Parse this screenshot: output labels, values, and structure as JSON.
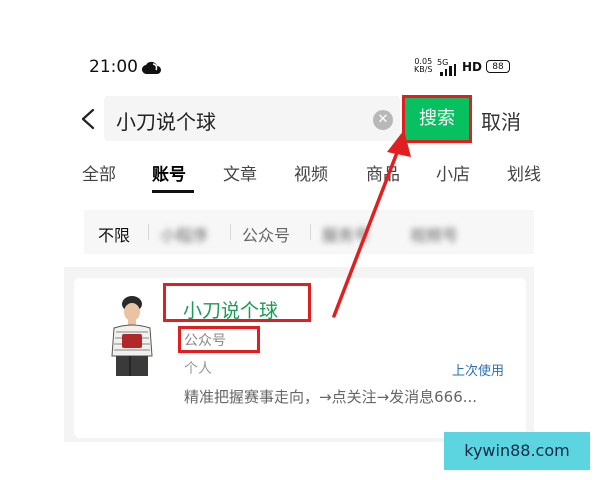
{
  "status_bar": {
    "time": "21:00",
    "net_speed_value": "0.05",
    "net_speed_unit": "KB/S",
    "network_type": "5G",
    "hd_label": "HD",
    "battery": "88"
  },
  "search": {
    "query": "小刀说个球",
    "search_button": "搜索",
    "cancel": "取消"
  },
  "tabs": [
    {
      "label": "全部"
    },
    {
      "label": "账号"
    },
    {
      "label": "文章"
    },
    {
      "label": "视频"
    },
    {
      "label": "商品"
    },
    {
      "label": "小店"
    },
    {
      "label": "划线"
    }
  ],
  "active_tab": "账号",
  "filters": [
    {
      "label": "不限"
    },
    {
      "label": "小程序"
    },
    {
      "label": "公众号"
    },
    {
      "label": "服务号"
    },
    {
      "label": "视频号"
    }
  ],
  "result": {
    "name": "小刀说个球",
    "type": "公众号",
    "category": "个人",
    "recent_label": "上次使用",
    "description": "精准把握赛事走向，→点关注→发消息666..."
  },
  "colors": {
    "accent_green": "#07c160",
    "annotation_red": "#e02020",
    "link_blue": "#2a6fb5"
  },
  "watermark": "kywin88.com"
}
